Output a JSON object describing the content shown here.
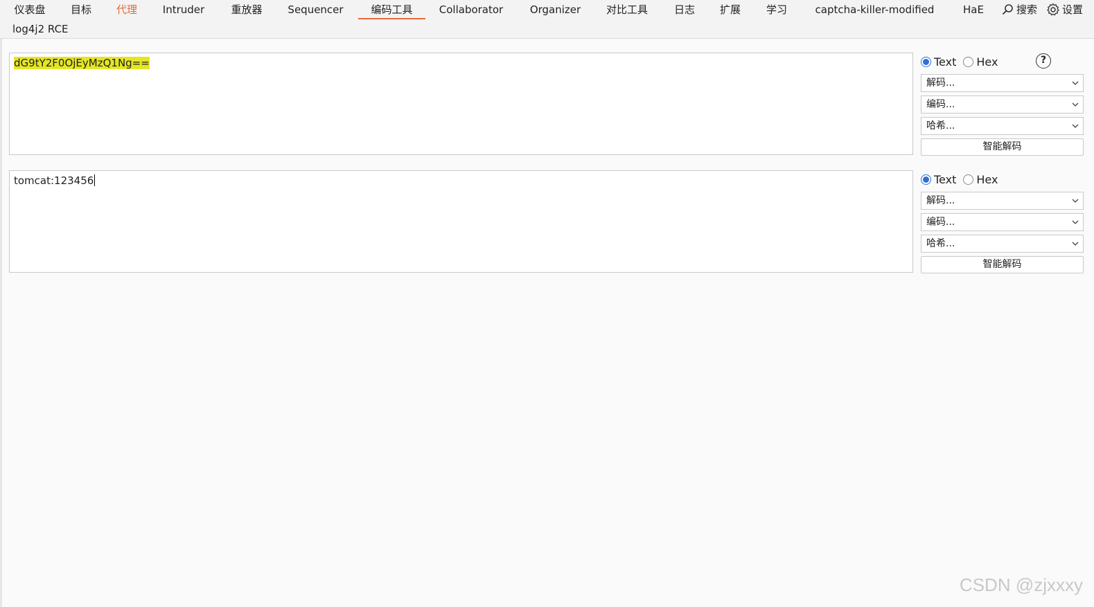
{
  "tabs": [
    {
      "label": "仪表盘"
    },
    {
      "label": "目标"
    },
    {
      "label": "代理"
    },
    {
      "label": "Intruder"
    },
    {
      "label": "重放器"
    },
    {
      "label": "Sequencer"
    },
    {
      "label": "编码工具"
    },
    {
      "label": "Collaborator"
    },
    {
      "label": "Organizer"
    },
    {
      "label": "对比工具"
    },
    {
      "label": "日志"
    },
    {
      "label": "扩展"
    },
    {
      "label": "学习"
    },
    {
      "label": "captcha-killer-modified"
    },
    {
      "label": "HaE"
    }
  ],
  "tab_row2": {
    "label": "log4j2 RCE"
  },
  "search": {
    "label": "搜索"
  },
  "settings": {
    "label": "设置"
  },
  "panels": [
    {
      "content": "dG9tY2F0OjEyMzQ1Ng==",
      "mode_text": "Text",
      "mode_hex": "Hex",
      "decode": "解码...",
      "encode": "编码...",
      "hash": "哈希...",
      "smart": "智能解码",
      "help": "?"
    },
    {
      "content": "tomcat:123456",
      "mode_text": "Text",
      "mode_hex": "Hex",
      "decode": "解码...",
      "encode": "编码...",
      "hash": "哈希...",
      "smart": "智能解码"
    }
  ],
  "watermark": "CSDN @zjxxxy",
  "colors": {
    "accent": "#e8683a",
    "highlight": "#e4e625",
    "radio": "#2f6fd1"
  }
}
